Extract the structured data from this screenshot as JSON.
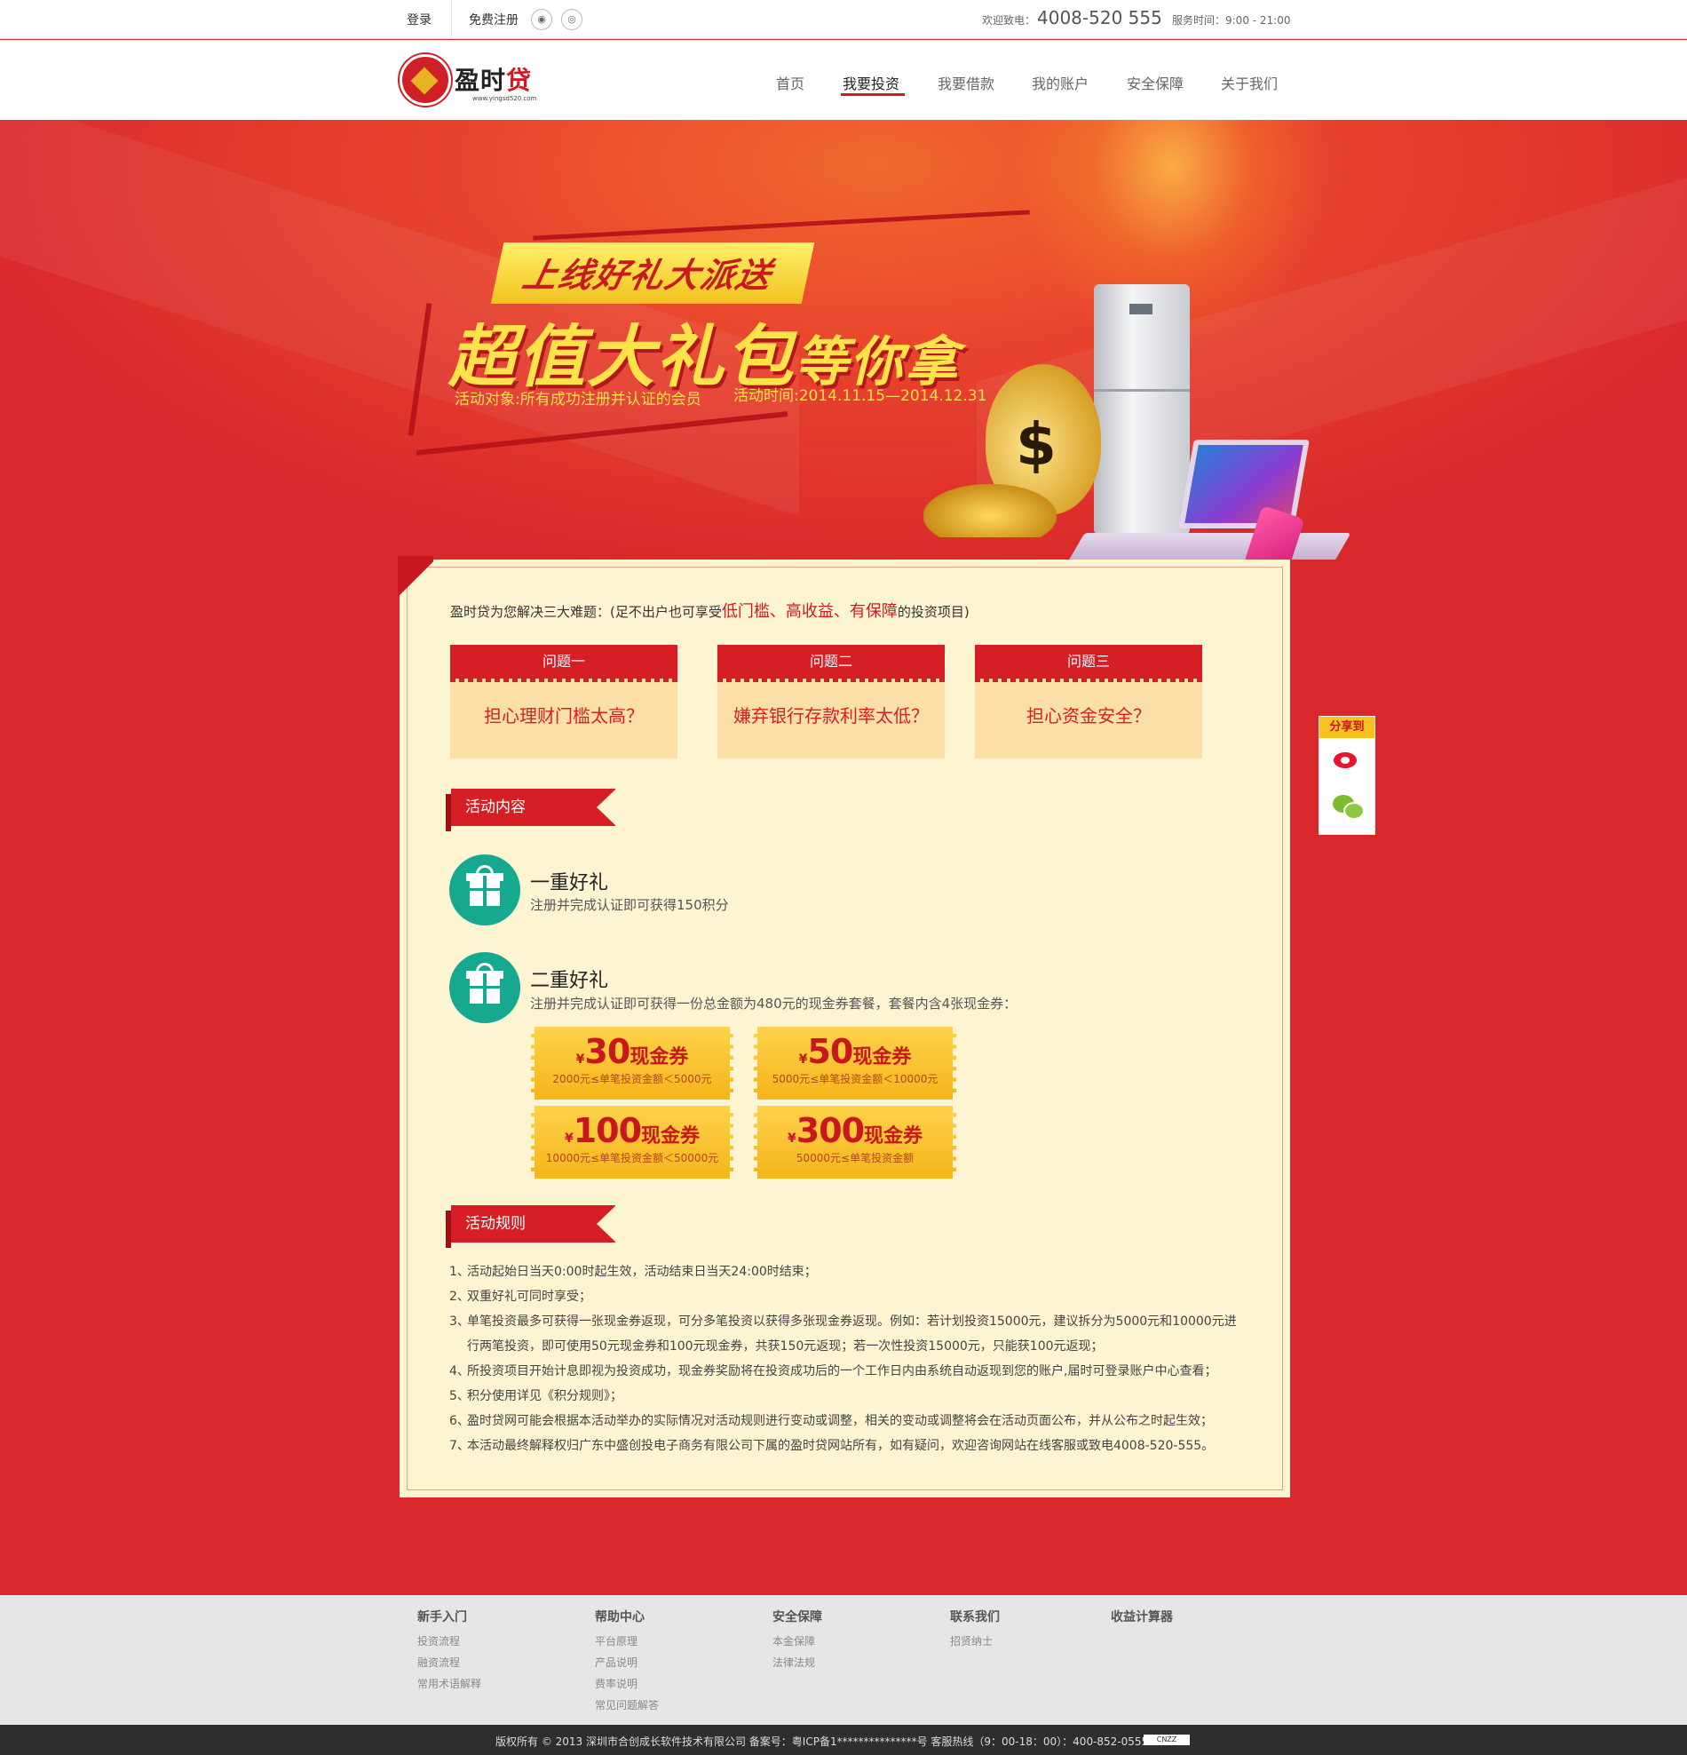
{
  "topbar": {
    "login": "登录",
    "register": "免费注册",
    "welcome": "欢迎致电：",
    "phone": "4008-520 555",
    "hours": "服务时间：9:00 - 21:00"
  },
  "header": {
    "logo_name": "盈时",
    "logo_name_hl": "贷",
    "logo_url": "www.yingsd520.com",
    "nav": [
      "首页",
      "我要投资",
      "我要借款",
      "我的账户",
      "安全保障",
      "关于我们"
    ],
    "active_nav": "我要投资"
  },
  "hero": {
    "ribbon": "上线好礼大派送",
    "big_a": "超值",
    "big_b": "大礼包",
    "big_c": "等你拿",
    "audience": "活动对象:所有成功注册并认证的会员",
    "period": "活动时间:2014.11.15—2014.12.31"
  },
  "intro": {
    "prefix": "盈时贷为您解决三大难题：(足不出户也可享受",
    "highlight": "低门槛、高收益、有保障",
    "suffix": "的投资项目)"
  },
  "questions": [
    {
      "head": "问题一",
      "text": "担心理财门槛太高？"
    },
    {
      "head": "问题二",
      "text": "嫌弃银行存款利率太低？"
    },
    {
      "head": "问题三",
      "text": "担心资金安全？"
    }
  ],
  "activity": {
    "tag": "活动内容",
    "gift1_title": "一重好礼",
    "gift1_desc": "注册并完成认证即可获得150积分",
    "gift2_title": "二重好礼",
    "gift2_desc": "注册并完成认证即可获得一份总金额为480元的现金券套餐，套餐内含4张现金券：",
    "coupons": [
      {
        "currency": "¥",
        "amount": "30",
        "label": "现金券",
        "range": "2000元≤单笔投资金额＜5000元"
      },
      {
        "currency": "¥",
        "amount": "50",
        "label": "现金券",
        "range": "5000元≤单笔投资金额＜10000元"
      },
      {
        "currency": "¥",
        "amount": "100",
        "label": "现金券",
        "range": "10000元≤单笔投资金额＜50000元"
      },
      {
        "currency": "¥",
        "amount": "300",
        "label": "现金券",
        "range": "50000元≤单笔投资金额"
      }
    ]
  },
  "rules": {
    "tag": "活动规则",
    "items": [
      {
        "n": "1、",
        "t": "活动起始日当天0:00时起生效，活动结束日当天24:00时结束；"
      },
      {
        "n": "2、",
        "t": "双重好礼可同时享受；"
      },
      {
        "n": "3、",
        "t": "单笔投资最多可获得一张现金券返现，可分多笔投资以获得多张现金券返现。例如：若计划投资15000元，建议拆分为5000元和10000元进行两笔投资，即可使用50元现金券和100元现金券，共获150元返现；若一次性投资15000元，只能获100元返现；"
      },
      {
        "n": "4、",
        "t": "所投资项目开始计息即视为投资成功，现金券奖励将在投资成功后的一个工作日内由系统自动返现到您的账户,届时可登录账户中心查看；"
      },
      {
        "n": "5、",
        "t": "积分使用详见《积分规则》；"
      },
      {
        "n": "6、",
        "t": "盈时贷网可能会根据本活动举办的实际情况对活动规则进行变动或调整，相关的变动或调整将会在活动页面公布，并从公布之时起生效；"
      },
      {
        "n": "7、",
        "t": "本活动最终解释权归广东中盛创投电子商务有限公司下属的盈时贷网站所有，如有疑问，欢迎咨询网站在线客服或致电4008-520-555。"
      }
    ]
  },
  "share": {
    "title": "分享到"
  },
  "footer": {
    "cols": [
      {
        "head": "新手入门",
        "items": [
          "投资流程",
          "融资流程",
          "常用术语解释"
        ]
      },
      {
        "head": "帮助中心",
        "items": [
          "平台原理",
          "产品说明",
          "费率说明",
          "常见问题解答"
        ]
      },
      {
        "head": "安全保障",
        "items": [
          "本金保障",
          "法律法规"
        ]
      },
      {
        "head": "联系我们",
        "items": [
          "招贤纳士"
        ]
      },
      {
        "head": "收益计算器",
        "items": []
      }
    ],
    "copyright": "版权所有 © 2013 深圳市合创成长软件技术有限公司 备案号：粤ICP备1***************号 客服热线（9：00-18：00）：400-852-0555",
    "cnzz": "CNZZ"
  }
}
